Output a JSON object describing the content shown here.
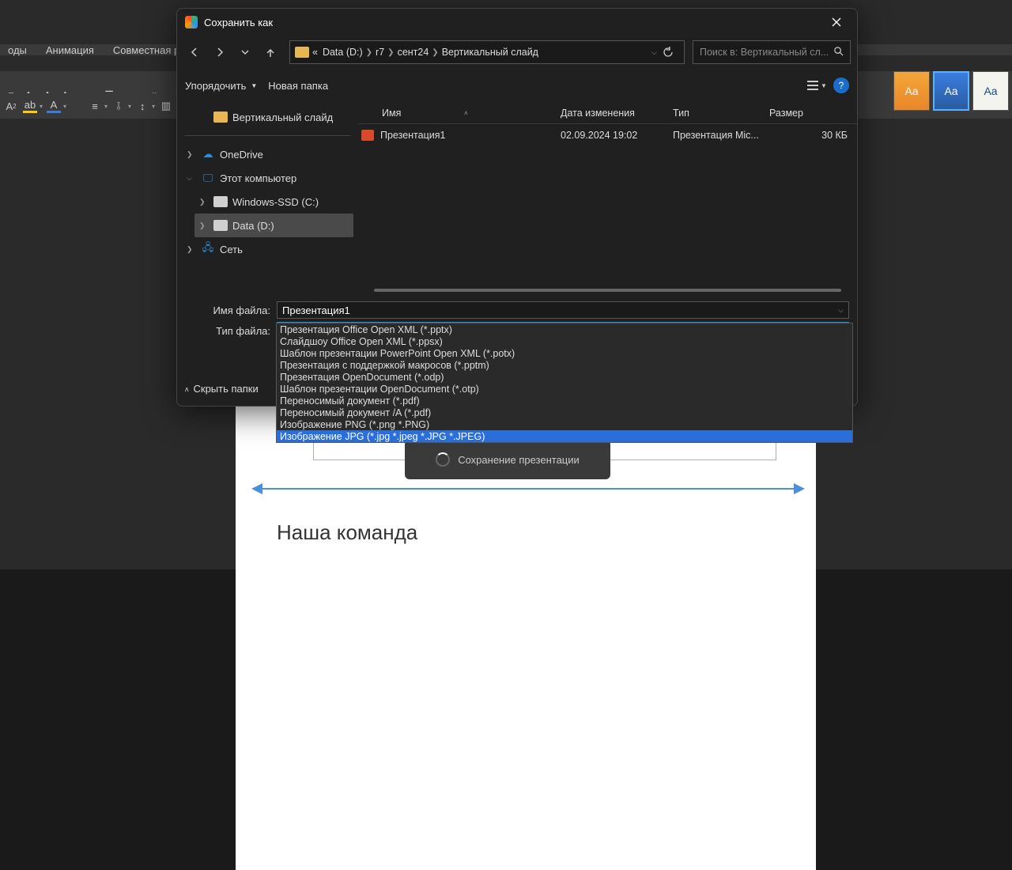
{
  "ribbon": {
    "tab1": "Анимация",
    "tab2": "Совместная раб",
    "tab0": "оды"
  },
  "styles": {
    "label": "Aa"
  },
  "dialog": {
    "title": "Сохранить как",
    "breadcrumb": {
      "prefix": "«",
      "p1": "Data (D:)",
      "p2": "r7",
      "p3": "сент24",
      "p4": "Вертикальный слайд"
    },
    "search_placeholder": "Поиск в: Вертикальный сл...",
    "organize": "Упорядочить",
    "new_folder": "Новая папка",
    "help": "?",
    "cols": {
      "name": "Имя",
      "date": "Дата изменения",
      "type": "Тип",
      "size": "Размер"
    },
    "tree": {
      "current_folder": "Вертикальный слайд",
      "onedrive": "OneDrive",
      "this_pc": "Этот компьютер",
      "drive_c": "Windows-SSD (C:)",
      "drive_d": "Data (D:)",
      "network": "Сеть"
    },
    "file": {
      "name": "Презентация1",
      "date": "02.09.2024 19:02",
      "type": "Презентация Mic...",
      "size": "30 КБ"
    },
    "filename_label": "Имя файла:",
    "filename_value": "Презентация1",
    "filetype_label": "Тип файла:",
    "filetype_value": "Презентация Office Open XML (*.pptx)",
    "hide_folders": "Скрыть папки",
    "dropdown": [
      "Презентация Office Open XML (*.pptx)",
      "Слайдшоу Office Open XML (*.ppsx)",
      "Шаблон презентации PowerPoint Open XML (*.potx)",
      "Презентация с поддержкой макросов (*.pptm)",
      "Презентация OpenDocument (*.odp)",
      "Шаблон презентации OpenDocument (*.otp)",
      "Переносимый документ (*.pdf)",
      "Переносимый документ /A (*.pdf)",
      "Изображение PNG (*.png *.PNG)",
      "Изображение JPG (*.jpg *.jpeg *.JPG *.JPEG)"
    ]
  },
  "slide": {
    "team_title": "Наша команда"
  },
  "toast": "Сохранение презентации"
}
